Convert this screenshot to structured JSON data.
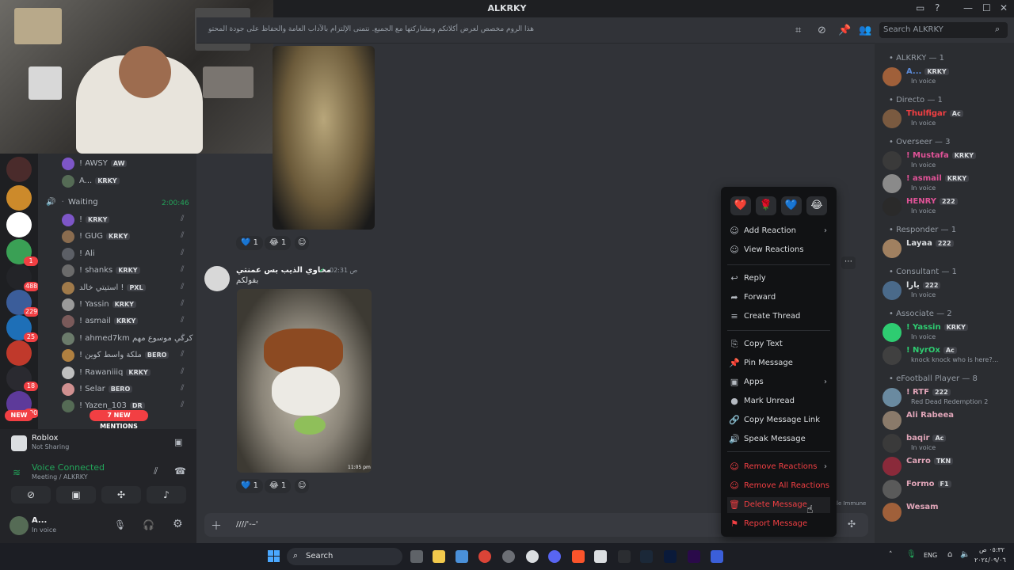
{
  "window": {
    "title": "ALKRKY",
    "controls": [
      "—",
      "☐",
      "✕"
    ]
  },
  "header": {
    "topic": "هذا الروم مخصص لعرض أكلاتكم ومشاركتها مع الجميع. نتمنى الإلتزام بالآداب العامة والحفاظ على جودة المحتو",
    "search_placeholder": "Search ALKRKY"
  },
  "sidebar": {
    "top_rows": [
      {
        "name": "! AWSY",
        "tag": "AW"
      },
      {
        "name": "A...",
        "tag": "KRKY"
      }
    ],
    "waiting_channel": {
      "name": "Waiting",
      "timer": "2:00:46"
    },
    "voice_users": [
      {
        "name": "!",
        "tag": "KRKY"
      },
      {
        "name": "! GUG",
        "tag": "KRKY"
      },
      {
        "name": "! Ali",
        "tag": ""
      },
      {
        "name": "! shanks",
        "tag": "KRKY"
      },
      {
        "name": "استيتي خالد !",
        "tag": "PXL"
      },
      {
        "name": "! Yassin",
        "tag": "KRKY"
      },
      {
        "name": "! asmail",
        "tag": "KRKY"
      },
      {
        "name": "! ahmed7km كركي موسوع مهم",
        "tag": ""
      },
      {
        "name": "! ملكة واسط كوين",
        "tag": "BERO"
      },
      {
        "name": "! Rawaniiiq",
        "tag": "KRKY"
      },
      {
        "name": "! Selar",
        "tag": "BERO"
      },
      {
        "name": "! Yazen_103",
        "tag": "DR"
      }
    ],
    "new_mentions": "7 NEW MENTIONS",
    "activity": {
      "name": "Roblox",
      "status": "Not Sharing"
    },
    "voice": {
      "status": "Voice Connected",
      "channel": "Meeting / ALKRKY"
    },
    "user": {
      "name": "A...",
      "status": "In voice"
    },
    "server_badges": [
      "1",
      "488",
      "229",
      "25",
      "18",
      "490"
    ],
    "new_label": "NEW"
  },
  "messages": [
    {
      "reactions": [
        {
          "emoji": "💙",
          "count": "1"
        },
        {
          "emoji": "😂",
          "count": "1"
        }
      ]
    },
    {
      "author": "مخاوي الذيب بس عمنتي",
      "time": "02:31 ص",
      "text": "بفولكم",
      "image_caption": "11:05 pm",
      "reactions": [
        {
          "emoji": "💙",
          "count": "1"
        },
        {
          "emoji": "😂",
          "count": "1"
        }
      ]
    }
  ],
  "composer": {
    "text": "////'-–'"
  },
  "context_menu": {
    "quick_emojis": [
      "❤️",
      "🌹",
      "💙",
      "😂"
    ],
    "items": [
      {
        "label": "Add Reaction",
        "icon": "☺",
        "arrow": true
      },
      {
        "label": "View Reactions",
        "icon": "☺"
      },
      {
        "label": "Reply",
        "icon": "↩"
      },
      {
        "label": "Forward",
        "icon": "➦"
      },
      {
        "label": "Create Thread",
        "icon": "≡"
      },
      {
        "label": "Copy Text",
        "icon": "⎘"
      },
      {
        "label": "Pin Message",
        "icon": "📌"
      },
      {
        "label": "Apps",
        "icon": "▣",
        "arrow": true
      },
      {
        "label": "Mark Unread",
        "icon": "●"
      },
      {
        "label": "Copy Message Link",
        "icon": "🔗"
      },
      {
        "label": "Speak Message",
        "icon": "🔊"
      },
      {
        "label": "Remove Reactions",
        "icon": "☺",
        "arrow": true,
        "danger": true
      },
      {
        "label": "Remove All Reactions",
        "icon": "☺",
        "danger": true
      },
      {
        "label": "Delete Message",
        "icon": "🗑",
        "danger": true
      },
      {
        "label": "Report Message",
        "icon": "⚑",
        "danger": true
      }
    ],
    "arrow_glyph": "›"
  },
  "members": {
    "groups": [
      {
        "header": "ALKRKY — 1",
        "members": [
          {
            "name": "A...",
            "tag": "KRKY",
            "status": "In voice",
            "color": "#5b8ad6"
          }
        ]
      },
      {
        "header": "Directo — 1",
        "members": [
          {
            "name": "Thulfigar",
            "tag": "Ac",
            "status": "In voice",
            "color": "#f23f43"
          }
        ]
      },
      {
        "header": "Overseer — 3",
        "members": [
          {
            "name": "! Mustafa",
            "tag": "KRKY",
            "status": "In voice",
            "color": "#e05297"
          },
          {
            "name": "! asmail",
            "tag": "KRKY",
            "status": "In voice",
            "color": "#e05297"
          },
          {
            "name": "HENRY",
            "tag": "222",
            "status": "In voice",
            "color": "#e05297"
          }
        ]
      },
      {
        "header": "Responder — 1",
        "members": [
          {
            "name": "Layaa",
            "tag": "222",
            "status": "",
            "color": "#dbdee1"
          }
        ]
      },
      {
        "header": "Consultant — 1",
        "members": [
          {
            "name": "يارا",
            "tag": "222",
            "status": "In voice",
            "color": "#dbdee1"
          }
        ]
      },
      {
        "header": "Associate — 2",
        "members": [
          {
            "name": "! Yassin",
            "tag": "KRKY",
            "status": "In voice",
            "color": "#2ecc71"
          },
          {
            "name": "! NyrOx",
            "tag": "Ac",
            "status": "knock knock who is here?...",
            "color": "#2ecc71"
          }
        ]
      },
      {
        "header": "eFootball Player — 8",
        "members": [
          {
            "name": "! RTF",
            "tag": "222",
            "status": "Red Dead Redemption 2",
            "color": "#e0a5b8"
          },
          {
            "name": "Ali Rabeea",
            "tag": "",
            "status": "",
            "color": "#e0a5b8"
          },
          {
            "name": "baqir",
            "tag": "Ac",
            "status": "In voice",
            "color": "#e0a5b8"
          },
          {
            "name": "Carro",
            "tag": "TKN",
            "status": "",
            "color": "#e0a5b8"
          },
          {
            "name": "Formo",
            "tag": "F1",
            "status": "",
            "color": "#e0a5b8"
          },
          {
            "name": "Wesam",
            "tag": "",
            "status": "",
            "color": "#e0a5b8"
          }
        ]
      }
    ],
    "footer_text": "le Immune"
  },
  "taskbar": {
    "search_label": "Search",
    "lang": "ENG",
    "time": "٠٥:٣٢ ص",
    "date": "٢٠٢٤/٠٩/٠٦"
  },
  "colors": {
    "accent": "#5865f2",
    "danger": "#f23f43",
    "voice_green": "#23a55a"
  }
}
